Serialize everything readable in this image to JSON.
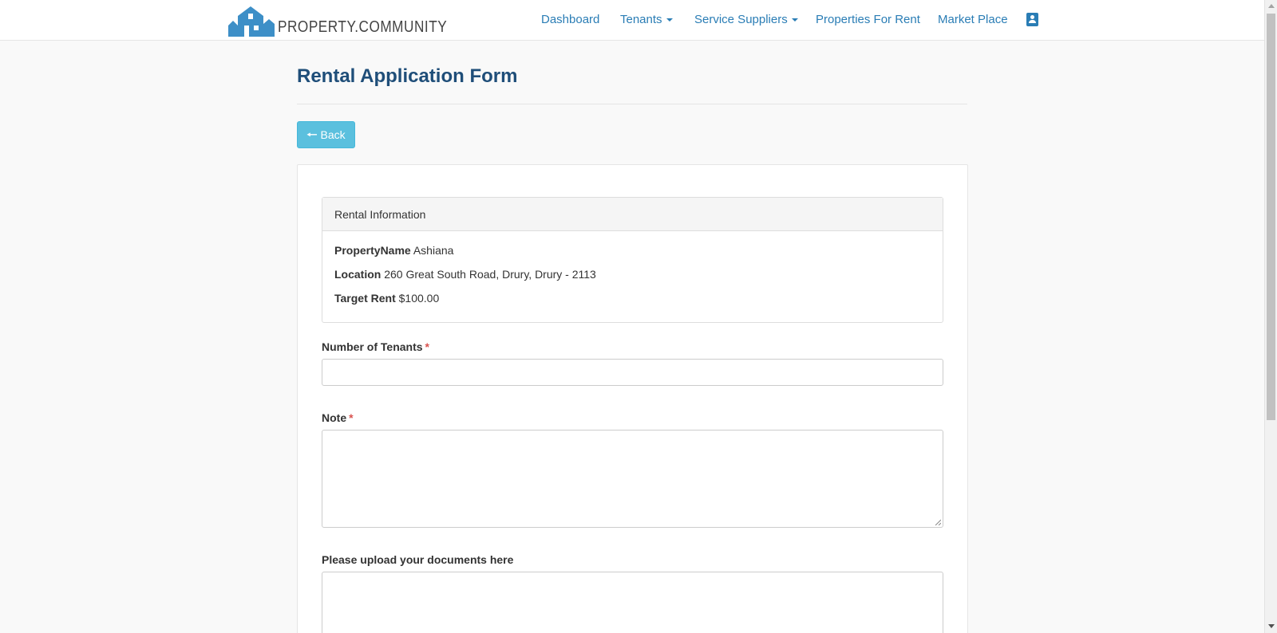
{
  "brand": {
    "name": "PROPERTY.COMMUNITY",
    "accent": "#2a7db5"
  },
  "nav": {
    "dashboard": "Dashboard",
    "tenants": "Tenants",
    "service_suppliers": "Service Suppliers",
    "properties_for_rent": "Properties For Rent",
    "market_place": "Market Place",
    "user_icon": "user-card-icon"
  },
  "page": {
    "title": "Rental Application Form",
    "back_label": "Back"
  },
  "rental_info": {
    "heading": "Rental Information",
    "property_name_label": "PropertyName",
    "property_name": "Ashiana",
    "location_label": "Location",
    "location": "260 Great South Road, Drury, Drury - 2113",
    "target_rent_label": "Target Rent",
    "target_rent": "$100.00"
  },
  "form": {
    "tenants_label": "Number of Tenants",
    "tenants_value": "",
    "note_label": "Note",
    "note_value": "",
    "upload_label": "Please upload your documents here",
    "required_mark": "*"
  }
}
